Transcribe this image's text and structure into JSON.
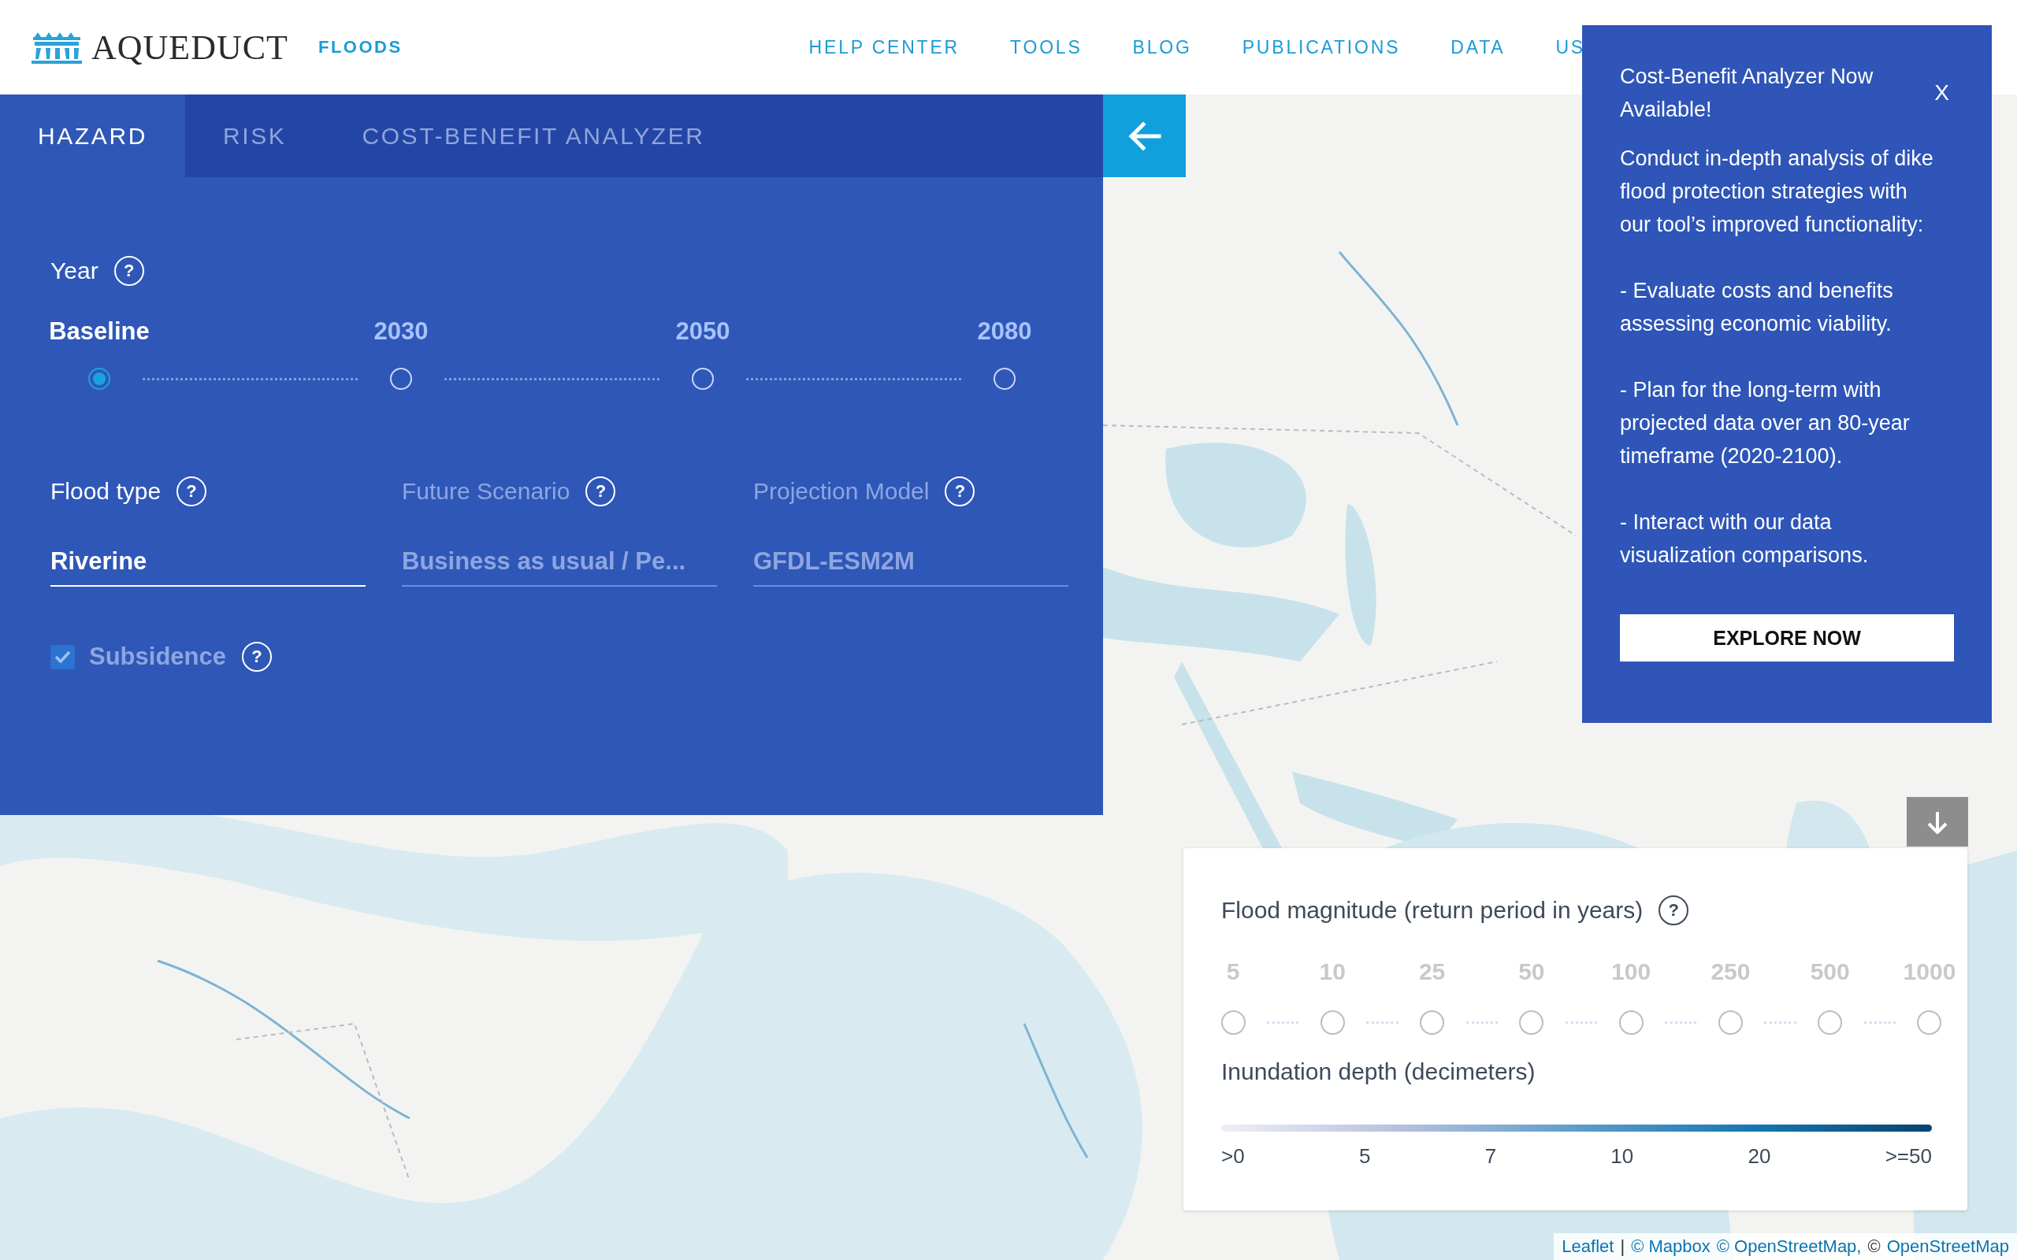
{
  "header": {
    "logo": "AQUEDUCT",
    "section": "FLOODS",
    "nav": [
      "HELP CENTER",
      "TOOLS",
      "BLOG",
      "PUBLICATIONS",
      "DATA",
      "US"
    ]
  },
  "tabs": [
    {
      "label": "HAZARD",
      "selected": true
    },
    {
      "label": "RISK",
      "selected": false
    },
    {
      "label": "COST-BENEFIT ANALYZER",
      "selected": false
    }
  ],
  "panel": {
    "year": {
      "label": "Year",
      "help": "?",
      "options": [
        {
          "label": "Baseline",
          "selected": true
        },
        {
          "label": "2030",
          "selected": false
        },
        {
          "label": "2050",
          "selected": false
        },
        {
          "label": "2080",
          "selected": false
        }
      ]
    },
    "selects": [
      {
        "label": "Flood type",
        "help": "?",
        "value": "Riverine",
        "disabled": false
      },
      {
        "label": "Future Scenario",
        "help": "?",
        "value": "Business as usual / Pe...",
        "disabled": true
      },
      {
        "label": "Projection Model",
        "help": "?",
        "value": "GFDL-ESM2M",
        "disabled": true
      }
    ],
    "subsidence": {
      "label": "Subsidence",
      "help": "?",
      "checked": true,
      "disabled": true
    }
  },
  "popup": {
    "title": "Cost-Benefit Analyzer Now Available!",
    "close": "X",
    "paragraphs": [
      "Conduct in-depth analysis of dike flood protection strategies with our tool’s improved functionality:",
      "- Evaluate costs and benefits assessing economic viability.",
      "- Plan for the long-term with projected data over an 80-year timeframe (2020-2100).",
      "- Interact with our data visualization comparisons."
    ],
    "button": "EXPLORE NOW"
  },
  "legend": {
    "magnitude": {
      "title": "Flood magnitude (return period in years)",
      "help": "?",
      "options": [
        {
          "label": "5",
          "selected": false,
          "disabled": true
        },
        {
          "label": "10",
          "selected": false,
          "disabled": true
        },
        {
          "label": "25",
          "selected": false,
          "disabled": true
        },
        {
          "label": "50",
          "selected": false,
          "disabled": true
        },
        {
          "label": "100",
          "selected": false,
          "disabled": true
        },
        {
          "label": "250",
          "selected": false,
          "disabled": true
        },
        {
          "label": "500",
          "selected": false,
          "disabled": true
        },
        {
          "label": "1000",
          "selected": false,
          "disabled": true
        }
      ]
    },
    "depth": {
      "title": "Inundation depth (decimeters)",
      "ticks": [
        ">0",
        "5",
        "7",
        "10",
        "20",
        ">=50"
      ]
    }
  },
  "attribution": [
    {
      "text": "Leaflet",
      "link": true
    },
    {
      "text": "|",
      "link": false
    },
    {
      "text": "© Mapbox",
      "link": true
    },
    {
      "text": "© OpenStreetMap,",
      "link": true
    },
    {
      "text": "©",
      "link": false
    },
    {
      "text": "OpenStreetMap",
      "link": true
    }
  ]
}
